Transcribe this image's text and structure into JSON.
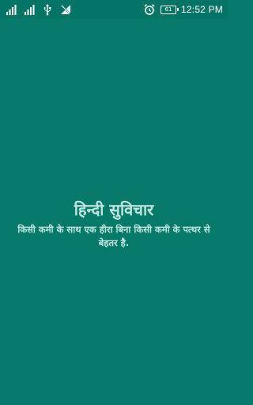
{
  "status_bar": {
    "battery_level": "61",
    "time": "12:52 PM",
    "icons_left": [
      "signal-icon",
      "signal-icon",
      "usb-icon",
      "no-network-icon"
    ],
    "icons_right": [
      "alarm-icon",
      "battery-icon"
    ]
  },
  "splash": {
    "title": "हिन्दी सुविचार",
    "quote": "किसी कमी के साथ एक हीरा बिना किसी कमी के पत्थर से बेहतर है."
  },
  "colors": {
    "background": "#05796a",
    "status_bar": "#047466",
    "text": "#bfe6df"
  }
}
